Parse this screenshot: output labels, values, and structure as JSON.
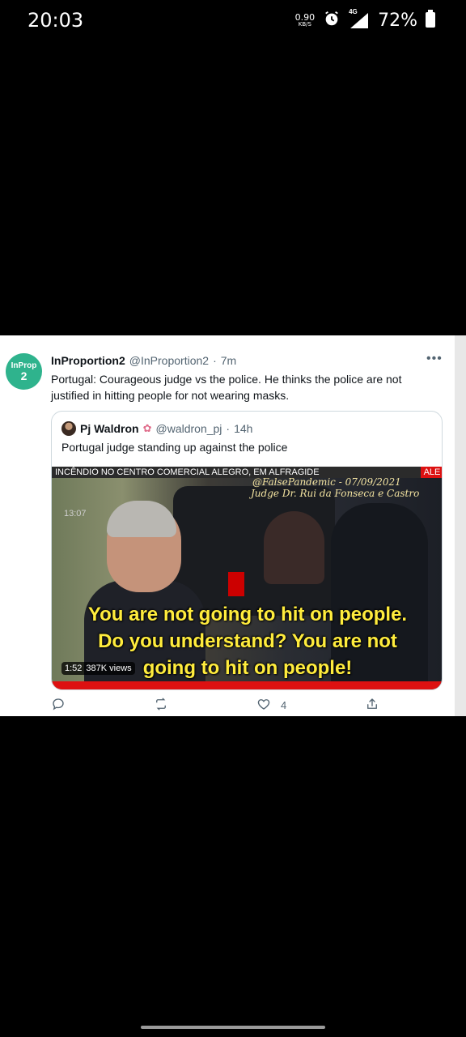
{
  "status_bar": {
    "time": "20:03",
    "net_speed_value": "0.90",
    "net_speed_unit": "KB/S",
    "network": "4G",
    "battery": "72%"
  },
  "tweet": {
    "author_name": "InProportion2",
    "author_handle": "@InProportion2",
    "time": "7m",
    "separator": "·",
    "avatar_line1": "InProp",
    "avatar_line2": "2",
    "text": "Portugal: Courageous judge vs the police. He thinks the police are not justified in  hitting people for not  wearing masks.",
    "more_label": "•••"
  },
  "quote": {
    "author_name": "Pj Waldron",
    "emoji": "✿",
    "author_handle": "@waldron_pj",
    "time": "14h",
    "separator": "·",
    "text": "Portugal judge standing up against the police",
    "video": {
      "ticker": "INCÊNDIO NO CENTRO COMERCIAL ALEGRO, EM ALFRAGIDE",
      "ticker_right": "ALE",
      "watermark_line1": "@FalsePandemic - 07/09/2021",
      "watermark_line2": "Judge Dr. Rui da Fonseca e Castro",
      "clock": "13:07",
      "subtitle_line1": "You are not going to hit on people.",
      "subtitle_line2": "Do you understand? You are not",
      "subtitle_line3": "going to hit on people!",
      "duration": "1:52",
      "views": "387K views"
    }
  },
  "actions": {
    "like_count": "4"
  }
}
